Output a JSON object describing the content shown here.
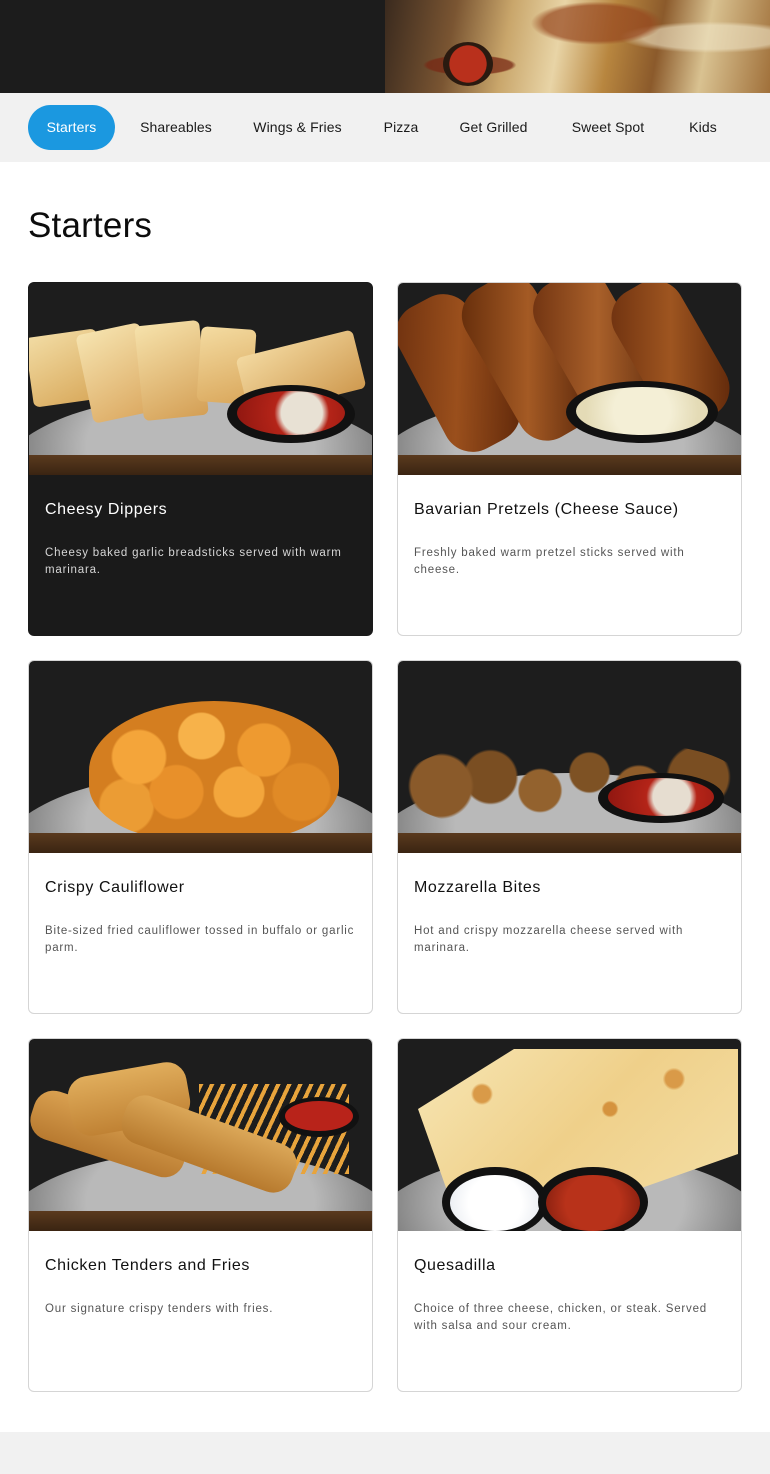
{
  "categories": [
    {
      "label": "Starters",
      "active": true
    },
    {
      "label": "Shareables",
      "active": false
    },
    {
      "label": "Wings & Fries",
      "active": false
    },
    {
      "label": "Pizza",
      "active": false
    },
    {
      "label": "Get Grilled",
      "active": false
    },
    {
      "label": "Sweet Spot",
      "active": false
    },
    {
      "label": "Kids",
      "active": false
    }
  ],
  "section": {
    "title": "Starters"
  },
  "items": [
    {
      "name": "Cheesy Dippers",
      "description": "Cheesy baked garlic breadsticks served with warm marinara.",
      "image_icon": "breadsticks-photo-icon"
    },
    {
      "name": "Bavarian Pretzels (Cheese Sauce)",
      "description": "Freshly baked warm pretzel sticks served with cheese.",
      "image_icon": "pretzels-photo-icon"
    },
    {
      "name": "Crispy Cauliflower",
      "description": "Bite-sized fried cauliflower tossed in buffalo or garlic parm.",
      "image_icon": "cauliflower-photo-icon"
    },
    {
      "name": "Mozzarella Bites",
      "description": "Hot and crispy mozzarella cheese served with marinara.",
      "image_icon": "mozzarella-bites-photo-icon"
    },
    {
      "name": "Chicken Tenders and Fries",
      "description": "Our signature crispy tenders with fries.",
      "image_icon": "chicken-tenders-photo-icon"
    },
    {
      "name": "Quesadilla",
      "description": "Choice of three cheese, chicken, or steak. Served with salsa and sour cream.",
      "image_icon": "quesadilla-photo-icon"
    }
  ],
  "colors": {
    "accent": "#1b98e0",
    "nav_background": "#f1f1f1",
    "highlight_card": "#1a1a1a"
  }
}
